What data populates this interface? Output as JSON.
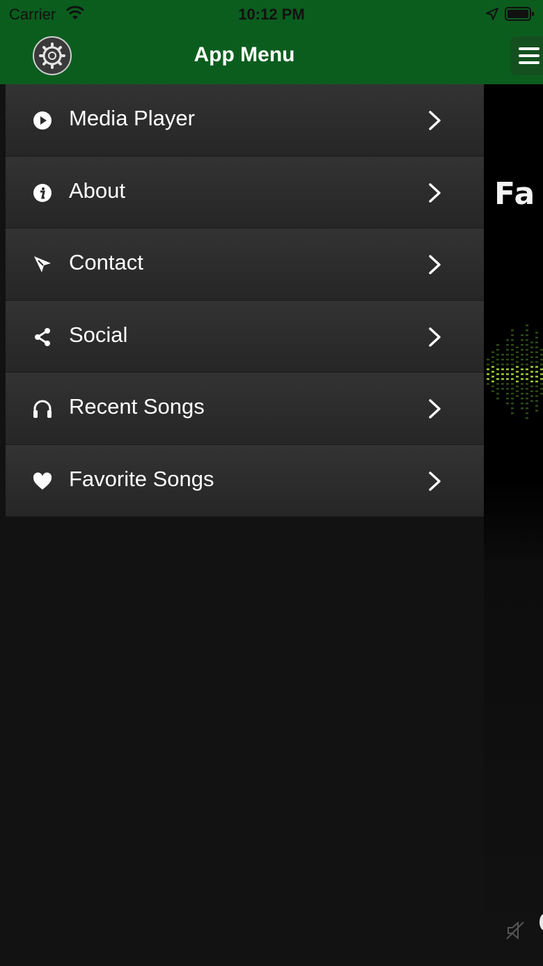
{
  "status_bar": {
    "carrier": "Carrier",
    "time": "10:12 PM"
  },
  "header": {
    "title": "App Menu",
    "settings_icon": "gear-icon",
    "menu_icon": "hamburger-icon"
  },
  "menu": {
    "items": [
      {
        "label": "Media Player",
        "icon": "play-circle-icon"
      },
      {
        "label": "About",
        "icon": "info-icon"
      },
      {
        "label": "Contact",
        "icon": "cursor-arrow-icon"
      },
      {
        "label": "Social",
        "icon": "share-icon"
      },
      {
        "label": "Recent Songs",
        "icon": "headphones-icon"
      },
      {
        "label": "Favorite Songs",
        "icon": "heart-icon"
      }
    ]
  },
  "background_app": {
    "title_fragment": "Fa"
  },
  "colors": {
    "header_green": "#0b5d1e",
    "menu_bg": "#2b2b2b",
    "page_bg": "#121212",
    "eq_green": "#9acd32"
  }
}
